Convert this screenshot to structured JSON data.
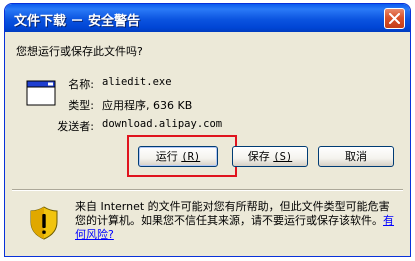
{
  "window": {
    "title": "文件下载 － 安全警告"
  },
  "dialog": {
    "question": "您想运行或保存此文件吗?",
    "file": {
      "name_label": "名称:",
      "name_value": "aliedit.exe",
      "type_label": "类型:",
      "type_value": "应用程序, 636 KB",
      "sender_label": "发送者:",
      "sender_value": "download.alipay.com"
    },
    "buttons": {
      "run_text": "运行",
      "run_mnemonic": "(R)",
      "save_text": "保存",
      "save_mnemonic": "(S)",
      "cancel": "取消"
    },
    "warning": {
      "text": "来自 Internet 的文件可能对您有所帮助，但此文件类型可能危害您的计算机。如果您不信任其来源，请不要运行或保存该软件。",
      "link": "有何风险?"
    }
  },
  "icons": {
    "close": "close-icon",
    "file": "application-window-icon",
    "shield": "security-shield-icon"
  },
  "colors": {
    "titlebar": "#0054e3",
    "dialog_bg": "#ece9d8",
    "highlight": "#e0141e",
    "link": "#0000ff"
  }
}
